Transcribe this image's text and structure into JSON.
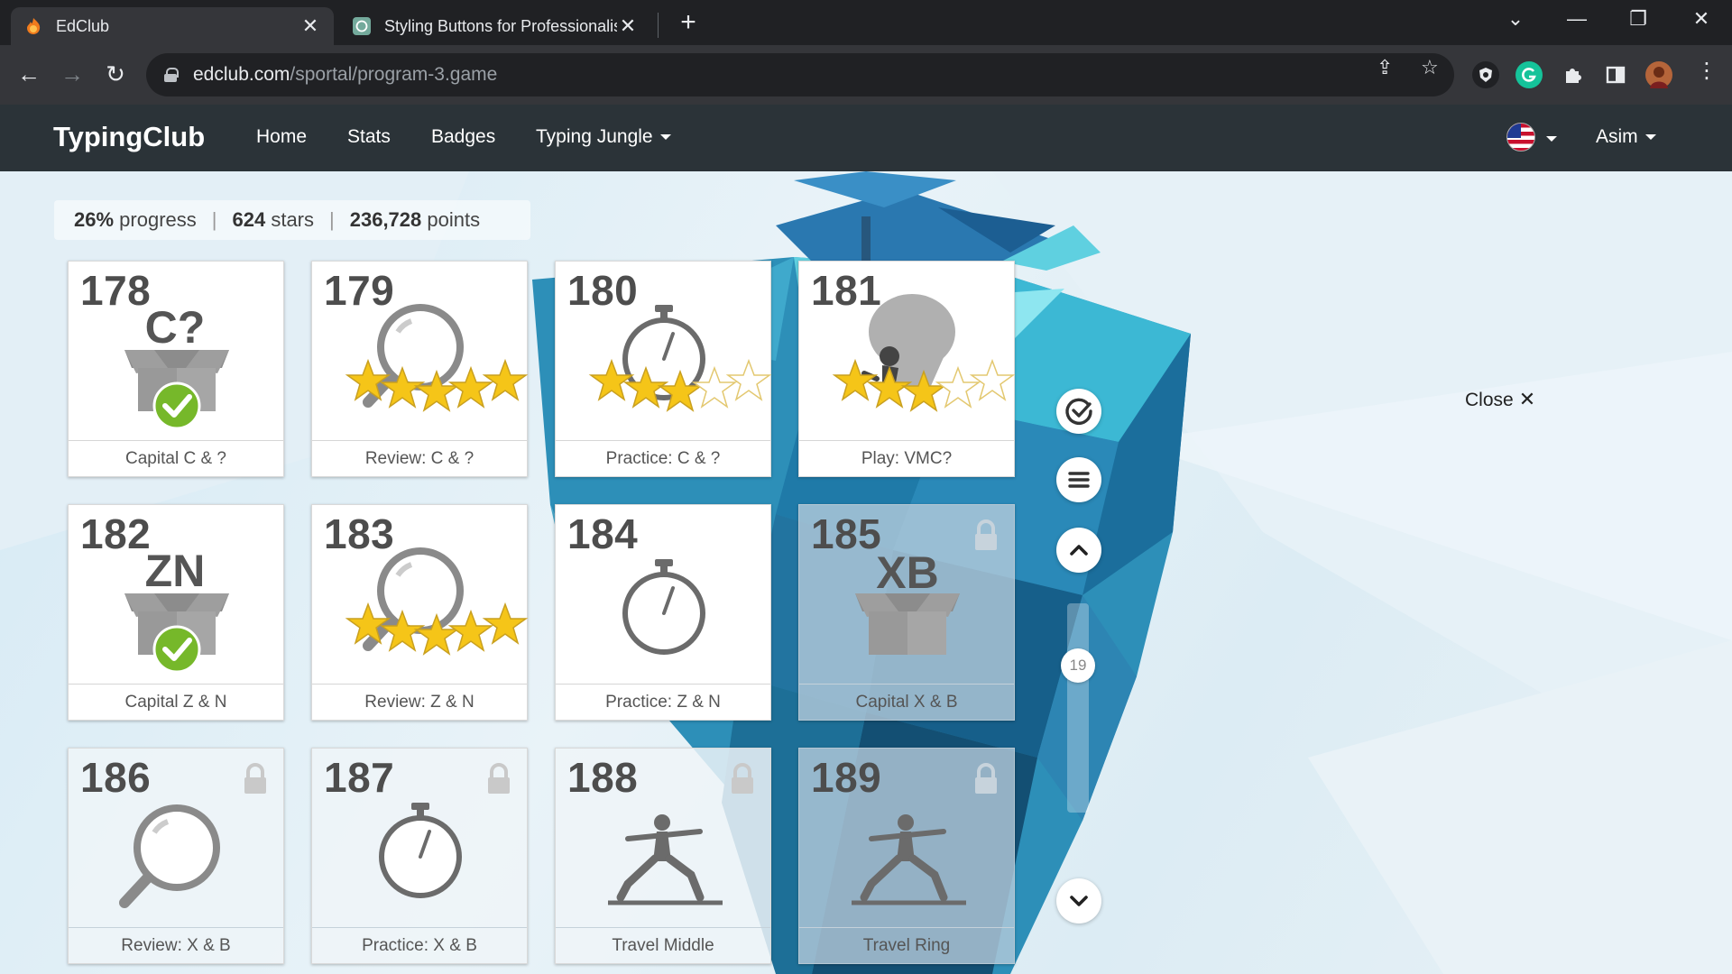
{
  "browser": {
    "tabs": [
      {
        "title": "EdClub",
        "active": true
      },
      {
        "title": "Styling Buttons for Professionalis",
        "active": false
      }
    ],
    "url_host": "edclub.com",
    "url_path": "/sportal/program-3.game"
  },
  "site": {
    "brand": "TypingClub",
    "nav": [
      "Home",
      "Stats",
      "Badges",
      "Typing Jungle"
    ],
    "user": "Asim"
  },
  "stats": {
    "progress_value": "26%",
    "progress_label": "progress",
    "stars_value": "624",
    "stars_label": "stars",
    "points_value": "236,728",
    "points_label": "points"
  },
  "lessons": [
    {
      "num": "178",
      "title": "Capital C & ?",
      "icon": "box-c-icon",
      "letters": "C?",
      "stars": null,
      "done": true,
      "locked": false
    },
    {
      "num": "179",
      "title": "Review: C & ?",
      "icon": "magnifier-icon",
      "stars": 5,
      "locked": false
    },
    {
      "num": "180",
      "title": "Practice: C & ?",
      "icon": "stopwatch-icon",
      "stars": 3,
      "locked": false
    },
    {
      "num": "181",
      "title": "Play: VMC?",
      "icon": "balloon-game-icon",
      "stars": 3,
      "locked": false
    },
    {
      "num": "182",
      "title": "Capital Z & N",
      "icon": "box-zn-icon",
      "letters": "ZN",
      "done": true,
      "locked": false
    },
    {
      "num": "183",
      "title": "Review: Z & N",
      "icon": "magnifier-icon",
      "stars": 5,
      "locked": false
    },
    {
      "num": "184",
      "title": "Practice: Z & N",
      "icon": "stopwatch-icon",
      "stars": 0,
      "locked": false
    },
    {
      "num": "185",
      "title": "Capital X & B",
      "icon": "box-xb-icon",
      "letters": "XB",
      "locked": true
    },
    {
      "num": "186",
      "title": "Review: X & B",
      "icon": "magnifier-icon",
      "locked": true
    },
    {
      "num": "187",
      "title": "Practice: X & B",
      "icon": "stopwatch-icon",
      "locked": true
    },
    {
      "num": "188",
      "title": "Travel Middle",
      "icon": "warrior-pose-icon",
      "locked": true
    },
    {
      "num": "189",
      "title": "Travel Ring",
      "icon": "warrior-pose-icon",
      "locked": true
    }
  ],
  "controls": {
    "scroll_page": "19",
    "close_label": "Close"
  },
  "colors": {
    "navbar": "#2b3338",
    "star": "#f5c518",
    "check": "#76b82a"
  }
}
